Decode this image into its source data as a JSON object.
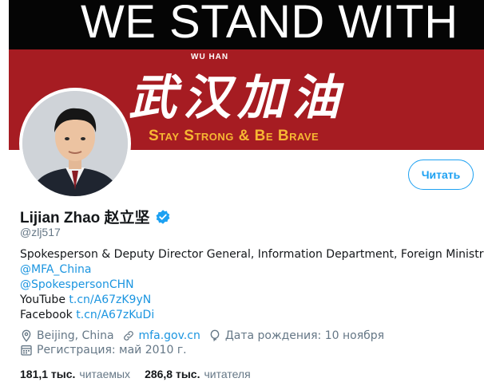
{
  "banner": {
    "headline": "WE STAND WITH",
    "city": "WU HAN",
    "chinese": "武汉加油",
    "slogan": "Stay Strong & Be Brave"
  },
  "profile": {
    "name": "Lijian Zhao 赵立坚",
    "handle": "@zlj517",
    "follow_label": "Читать"
  },
  "bio": {
    "line1": "Spokesperson & Deputy Director General, Information Department, Foreign Ministry.",
    "mention1": "@MFA_China",
    "mention2": "@SpokespersonCHN",
    "youtube_label": "YouTube ",
    "youtube_link": "t.cn/A67zK9yN",
    "facebook_label": "Facebook ",
    "facebook_link": "t.cn/A67zKuDi"
  },
  "meta": {
    "location": "Beijing, China",
    "website": "mfa.gov.cn",
    "birthday": "Дата рождения: 10 ноября",
    "joined": "Регистрация: май 2010 г."
  },
  "stats": {
    "following_count": "181,1 тыс.",
    "following_label": "читаемых",
    "followers_count": "286,8 тыс.",
    "followers_label": "читателя"
  },
  "colors": {
    "accent": "#1da1f2",
    "link": "#1b95e0",
    "banner_red": "#a61c22",
    "banner_black": "#050505",
    "slogan": "#f7b733",
    "muted": "#657786"
  },
  "icons": [
    "verified-badge-icon",
    "location-icon",
    "link-icon",
    "balloon-icon",
    "calendar-icon"
  ]
}
